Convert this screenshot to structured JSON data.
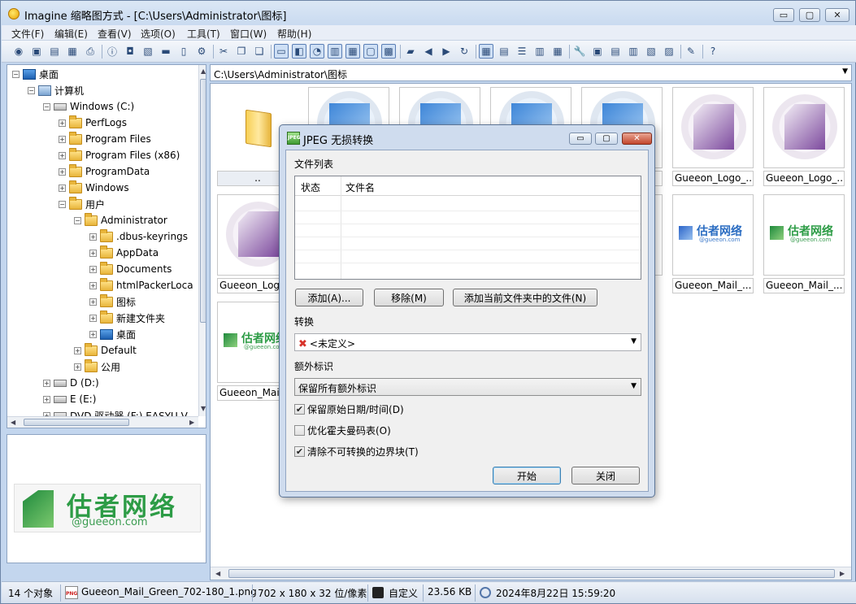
{
  "window": {
    "title": "Imagine 缩略图方式 - [C:\\Users\\Administrator\\图标]",
    "min": "▭",
    "max": "▢",
    "close": "✕"
  },
  "menu": [
    "文件(F)",
    "编辑(E)",
    "查看(V)",
    "选项(O)",
    "工具(T)",
    "窗口(W)",
    "帮助(H)"
  ],
  "toolbar": {
    "icons": [
      "eye-icon",
      "view-icon",
      "open-folder-icon",
      "save-icon",
      "print-icon",
      "info-icon",
      "camera-icon",
      "new-folder-icon",
      "scan-icon",
      "delete-icon",
      "settings-icon",
      "cut-icon",
      "copy-icon",
      "paste-icon",
      "film-icon",
      "slideshow-icon",
      "timer-icon",
      "filter-icon",
      "grid-icon",
      "frame-icon",
      "picture-icon",
      "browse-folder-icon",
      "back-arrow-icon",
      "forward-arrow-icon",
      "refresh-icon",
      "thumb-view-icon",
      "small-icon-view-icon",
      "list-view-icon",
      "detail-view-icon",
      "report-view-icon",
      "wrench-icon",
      "batch-icon",
      "convert-icon",
      "export-icon",
      "effects-icon",
      "plugin-icon",
      "edit-icon",
      "help-icon"
    ]
  },
  "tree": [
    {
      "label": "桌面",
      "indent": 0,
      "icon": "desktop"
    },
    {
      "label": "计算机",
      "indent": 1,
      "icon": "pc"
    },
    {
      "label": "Windows (C:)",
      "indent": 2,
      "icon": "drive"
    },
    {
      "label": "PerfLogs",
      "indent": 3,
      "icon": "folder"
    },
    {
      "label": "Program Files",
      "indent": 3,
      "icon": "folder"
    },
    {
      "label": "Program Files (x86)",
      "indent": 3,
      "icon": "folder"
    },
    {
      "label": "ProgramData",
      "indent": 3,
      "icon": "folder"
    },
    {
      "label": "Windows",
      "indent": 3,
      "icon": "folder"
    },
    {
      "label": "用户",
      "indent": 3,
      "icon": "folder"
    },
    {
      "label": "Administrator",
      "indent": 4,
      "icon": "folder"
    },
    {
      "label": ".dbus-keyrings",
      "indent": 5,
      "icon": "folder"
    },
    {
      "label": "AppData",
      "indent": 5,
      "icon": "folder"
    },
    {
      "label": "Documents",
      "indent": 5,
      "icon": "folder"
    },
    {
      "label": "htmlPackerLoca",
      "indent": 5,
      "icon": "folder"
    },
    {
      "label": "图标",
      "indent": 5,
      "icon": "folder"
    },
    {
      "label": "新建文件夹",
      "indent": 5,
      "icon": "folder"
    },
    {
      "label": "桌面",
      "indent": 5,
      "icon": "desktop"
    },
    {
      "label": "Default",
      "indent": 4,
      "icon": "folder"
    },
    {
      "label": "公用",
      "indent": 4,
      "icon": "folder"
    },
    {
      "label": "D (D:)",
      "indent": 2,
      "icon": "drive"
    },
    {
      "label": "E (E:)",
      "indent": 2,
      "icon": "drive"
    },
    {
      "label": "DVD 驱动器 (F:) EASYU V",
      "indent": 2,
      "icon": "drive"
    }
  ],
  "preview": {
    "logo_text": "估者网络",
    "logo_sub": "@gueeon.com"
  },
  "path": "C:\\Users\\Administrator\\图标",
  "thumbnails": [
    {
      "label": "..",
      "kind": "folder"
    },
    {
      "label": "",
      "kind": "blue"
    },
    {
      "label": "",
      "kind": "blue"
    },
    {
      "label": "",
      "kind": "blue"
    },
    {
      "label": "",
      "kind": "blue"
    },
    {
      "label": "Gueeon_Logo_...",
      "kind": "purple"
    },
    {
      "label": "Gueeon_Logo_...",
      "kind": "purple"
    },
    {
      "label": "Gueeon_Logo_",
      "kind": "purple"
    },
    {
      "label": "",
      "kind": "blank"
    },
    {
      "label": "",
      "kind": "blank"
    },
    {
      "label": "",
      "kind": "blank"
    },
    {
      "label": "",
      "kind": "blank"
    },
    {
      "label": "Gueeon_Mail_...",
      "kind": "mailblue"
    },
    {
      "label": "Gueeon_Mail_...",
      "kind": "mailgreen"
    },
    {
      "label": "Gueeon_Mai",
      "kind": "mailgreen"
    }
  ],
  "thumb_logo": {
    "text": "估者网络",
    "sub": "@gueeon.com",
    "partial": "估者网络"
  },
  "status": {
    "count": "14 个对象",
    "file": "Gueeon_Mail_Green_702-180_1.png",
    "dims": "702 x 180 x 32 位/像素",
    "custom": "自定义",
    "size": "23.56 KB",
    "date": "2024年8月22日 15:59:20"
  },
  "dialog": {
    "title": "JPEG 无损转换",
    "file_list_label": "文件列表",
    "col_status": "状态",
    "col_filename": "文件名",
    "add_btn": "添加(A)...",
    "remove_btn": "移除(M)",
    "add_folder_btn": "添加当前文件夹中的文件(N)",
    "convert_label": "转换",
    "convert_value": "<未定义>",
    "extra_label": "额外标识",
    "extra_value": "保留所有额外标识",
    "chk_keep_date": "保留原始日期/时间(D)",
    "chk_optimize": "优化霍夫曼码表(O)",
    "chk_trim": "清除不可转换的边界块(T)",
    "chk_keep_date_checked": true,
    "chk_optimize_checked": false,
    "chk_trim_checked": true,
    "start_btn": "开始",
    "close_btn": "关闭"
  }
}
